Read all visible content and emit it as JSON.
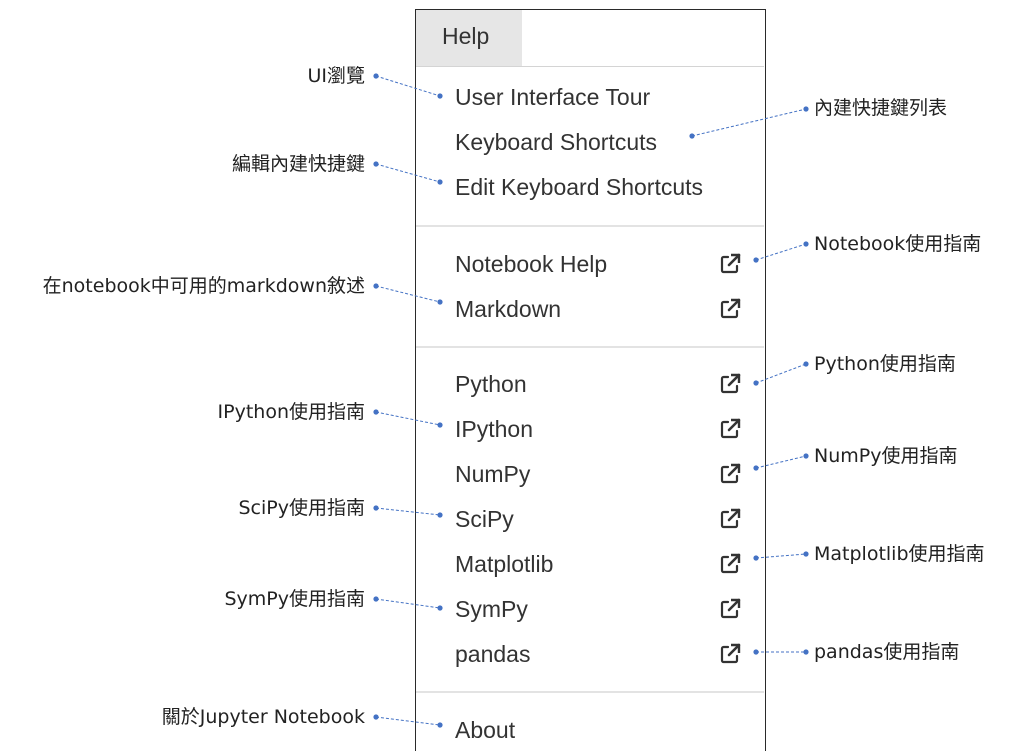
{
  "menu": {
    "title": "Help",
    "items": [
      {
        "label": "User Interface Tour",
        "external": false
      },
      {
        "label": "Keyboard Shortcuts",
        "external": false
      },
      {
        "label": "Edit Keyboard Shortcuts",
        "external": false
      },
      {
        "label": "Notebook Help",
        "external": true
      },
      {
        "label": "Markdown",
        "external": true
      },
      {
        "label": "Python",
        "external": true
      },
      {
        "label": "IPython",
        "external": true
      },
      {
        "label": "NumPy",
        "external": true
      },
      {
        "label": "SciPy",
        "external": true
      },
      {
        "label": "Matplotlib",
        "external": true
      },
      {
        "label": "SymPy",
        "external": true
      },
      {
        "label": "pandas",
        "external": true
      },
      {
        "label": "About",
        "external": false
      }
    ]
  },
  "annotations": {
    "ui_tour": "UI瀏覽",
    "edit_shortcuts": "編輯內建快捷鍵",
    "markdown": "在notebook中可用的markdown敘述",
    "ipython": "IPython使用指南",
    "scipy": "SciPy使用指南",
    "sympy": "SymPy使用指南",
    "about": "關於Jupyter Notebook",
    "shortcuts_list": "內建快捷鍵列表",
    "notebook_help": "Notebook使用指南",
    "python": "Python使用指南",
    "numpy": "NumPy使用指南",
    "matplotlib": "Matplotlib使用指南",
    "pandas": "pandas使用指南"
  },
  "colors": {
    "annotation_line": "#4472c4",
    "menu_text": "#333333",
    "header_tab_bg": "#e6e6e6",
    "divider": "#e3e3e3"
  },
  "icons": {
    "external_link": "external-link-icon"
  }
}
